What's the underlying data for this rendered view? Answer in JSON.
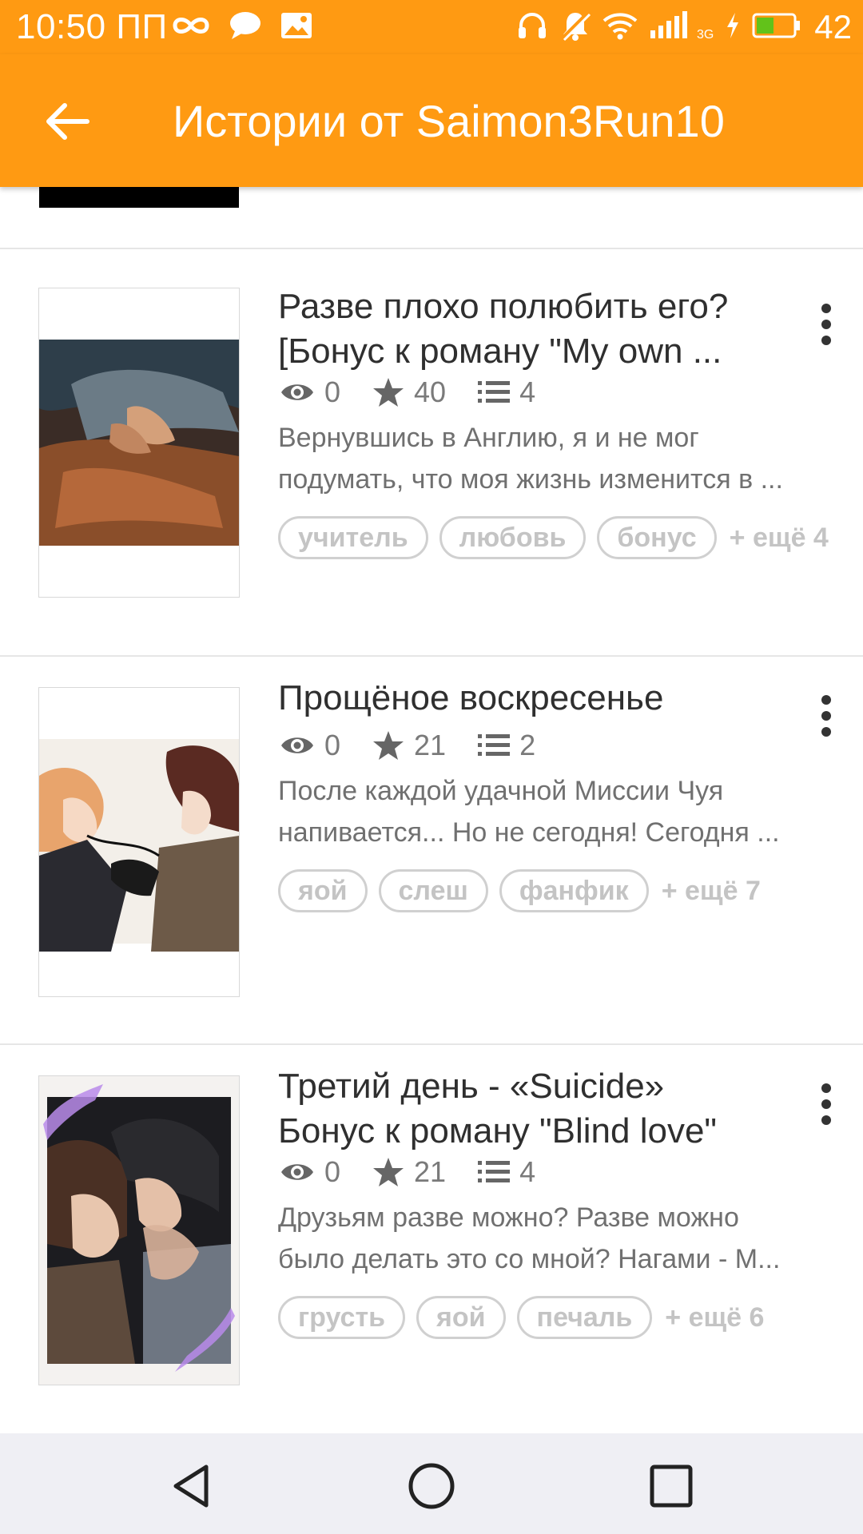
{
  "status_bar": {
    "time": "10:50 ПП",
    "battery_level": "42",
    "network_type": "3G",
    "left_icons": [
      "infinity-icon",
      "chat-bubble-icon",
      "image-notification-icon"
    ],
    "right_icons": [
      "headphones-icon",
      "muted-bell-icon",
      "wifi-icon",
      "signal-icon",
      "charging-icon",
      "battery-icon"
    ]
  },
  "toolbar": {
    "back_icon": "arrow-left-icon",
    "title": "Истории от Saimon3Run10"
  },
  "colors": {
    "accent": "#ff9a12",
    "title_text": "#2f2f2f",
    "secondary_text": "#707070",
    "tag_text": "#c4c4c4",
    "divider": "#e6e6e6",
    "nav_background": "#efeff4"
  },
  "stories": [
    {
      "title_lines": [
        "Разве плохо полюбить его?",
        "[Бонус к роману \"My own ..."
      ],
      "views": "0",
      "votes": "40",
      "parts": "4",
      "description_lines": [
        "Вернувшись в Англию, я и не мог",
        "подумать, что моя жизнь изменится в ..."
      ],
      "tags": [
        "учитель",
        "любовь",
        "бонус"
      ],
      "more_tags": "+ ещё 4"
    },
    {
      "title_lines": [
        "Прощёное воскресенье"
      ],
      "views": "0",
      "votes": "21",
      "parts": "2",
      "description_lines": [
        "После каждой удачной Миссии Чуя",
        "напивается... Но не сегодня! Сегодня ..."
      ],
      "tags": [
        "яой",
        "слеш",
        "фанфик"
      ],
      "more_tags": "+ ещё 7"
    },
    {
      "title_lines": [
        "Третий день - «Suicide»",
        "Бонус к роману \"Blind love\""
      ],
      "views": "0",
      "votes": "21",
      "parts": "4",
      "description_lines": [
        "Друзьям разве можно? Разве можно",
        "было делать это со мной? Нагами - М..."
      ],
      "tags": [
        "грусть",
        "яой",
        "печаль"
      ],
      "more_tags": "+ ещё 6"
    }
  ],
  "nav_bar": {
    "icons": [
      "back-triangle-icon",
      "home-circle-icon",
      "recents-square-icon"
    ]
  }
}
